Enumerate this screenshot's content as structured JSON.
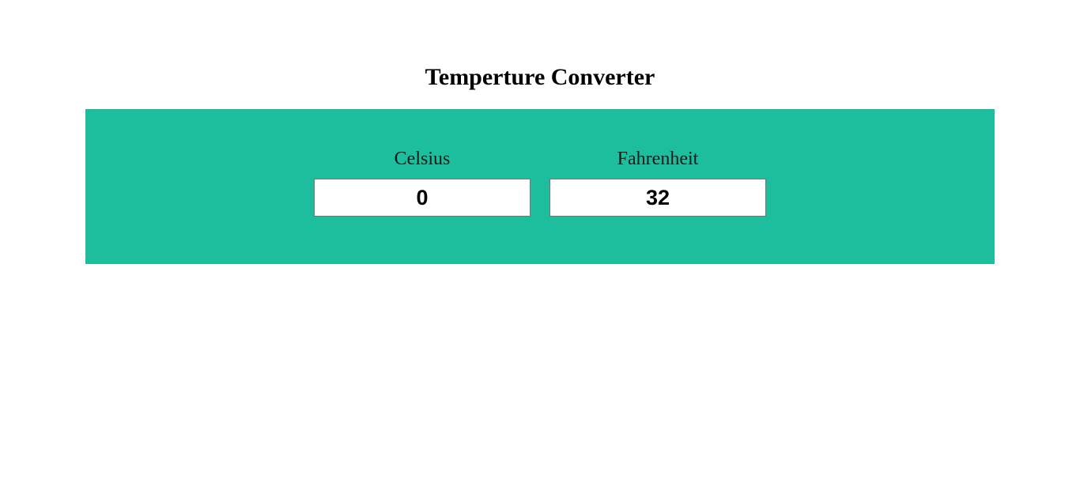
{
  "header": {
    "title": "Temperture Converter"
  },
  "converter": {
    "celsius": {
      "label": "Celsius",
      "value": "0"
    },
    "fahrenheit": {
      "label": "Fahrenheit",
      "value": "32"
    }
  },
  "colors": {
    "panel_background": "#1cbe9d",
    "page_background": "#ffffff",
    "input_border": "#767676"
  }
}
